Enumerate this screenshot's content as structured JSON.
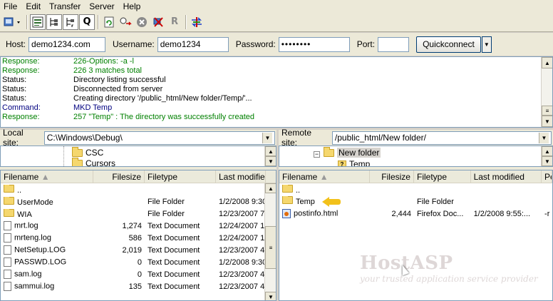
{
  "menu": [
    "File",
    "Edit",
    "Transfer",
    "Server",
    "Help"
  ],
  "toolbar": {
    "icons": [
      "site-manager-icon",
      "toggle-log-icon",
      "toggle-local-tree-icon",
      "toggle-remote-tree-icon",
      "toggle-queue-icon",
      "refresh-icon",
      "process-queue-icon",
      "cancel-icon",
      "disconnect-icon",
      "reconnect-icon",
      "compare-icon"
    ],
    "queue_glyph": "Q",
    "reconnect_glyph": "R"
  },
  "quickconnect": {
    "host_label": "Host:",
    "host_value": "demo1234.com",
    "username_label": "Username:",
    "username_value": "demo1234",
    "password_label": "Password:",
    "password_value": "••••••••",
    "port_label": "Port:",
    "port_value": "",
    "button_label": "Quickconnect"
  },
  "log": [
    {
      "kind": "Response:",
      "msg": "226-Options: -a -l",
      "color": "green"
    },
    {
      "kind": "Response:",
      "msg": "226 3 matches total",
      "color": "green"
    },
    {
      "kind": "Status:",
      "msg": "Directory listing successful",
      "color": "black"
    },
    {
      "kind": "Status:",
      "msg": "Disconnected from server",
      "color": "black"
    },
    {
      "kind": "Status:",
      "msg": "Creating directory '/public_html/New folder/Temp/'...",
      "color": "black"
    },
    {
      "kind": "Command:",
      "msg": "MKD Temp",
      "color": "blue"
    },
    {
      "kind": "Response:",
      "msg": "257 \"Temp\" : The directory was successfully created",
      "color": "green"
    }
  ],
  "local": {
    "label": "Local site:",
    "path": "C:\\Windows\\Debug\\",
    "tree": [
      "CSC",
      "Cursors"
    ],
    "columns": [
      "Filename",
      "Filesize",
      "Filetype",
      "Last modified"
    ],
    "files": [
      {
        "name": "..",
        "size": "",
        "type": "",
        "modified": "",
        "icon": "folder"
      },
      {
        "name": "UserMode",
        "size": "",
        "type": "File Folder",
        "modified": "1/2/2008 9:30:3",
        "icon": "folder"
      },
      {
        "name": "WIA",
        "size": "",
        "type": "File Folder",
        "modified": "12/23/2007 7:19",
        "icon": "folder"
      },
      {
        "name": "mrt.log",
        "size": "1,274",
        "type": "Text Document",
        "modified": "12/24/2007 10:4",
        "icon": "doc"
      },
      {
        "name": "mrteng.log",
        "size": "586",
        "type": "Text Document",
        "modified": "12/24/2007 10:4",
        "icon": "doc"
      },
      {
        "name": "NetSetup.LOG",
        "size": "2,019",
        "type": "Text Document",
        "modified": "12/23/2007 4:34",
        "icon": "doc"
      },
      {
        "name": "PASSWD.LOG",
        "size": "0",
        "type": "Text Document",
        "modified": "1/2/2008 9:30:3",
        "icon": "doc"
      },
      {
        "name": "sam.log",
        "size": "0",
        "type": "Text Document",
        "modified": "12/23/2007 4:23",
        "icon": "doc"
      },
      {
        "name": "sammui.log",
        "size": "135",
        "type": "Text Document",
        "modified": "12/23/2007 4:23",
        "icon": "doc"
      }
    ]
  },
  "remote": {
    "label": "Remote site:",
    "path": "/public_html/New folder/",
    "tree": [
      "New folder",
      "Temp"
    ],
    "columns": [
      "Filename",
      "Filesize",
      "Filetype",
      "Last modified",
      "Pe"
    ],
    "files": [
      {
        "name": "..",
        "size": "",
        "type": "",
        "modified": "",
        "perm": "",
        "icon": "folder"
      },
      {
        "name": "Temp",
        "size": "",
        "type": "File Folder",
        "modified": "",
        "perm": "",
        "icon": "folder"
      },
      {
        "name": "postinfo.html",
        "size": "2,444",
        "type": "Firefox Doc...",
        "modified": "1/2/2008 9:55:...",
        "perm": "-r",
        "icon": "html"
      }
    ]
  },
  "watermark": {
    "brand": "HostASP",
    "tagline": "your trusted application service provider"
  }
}
